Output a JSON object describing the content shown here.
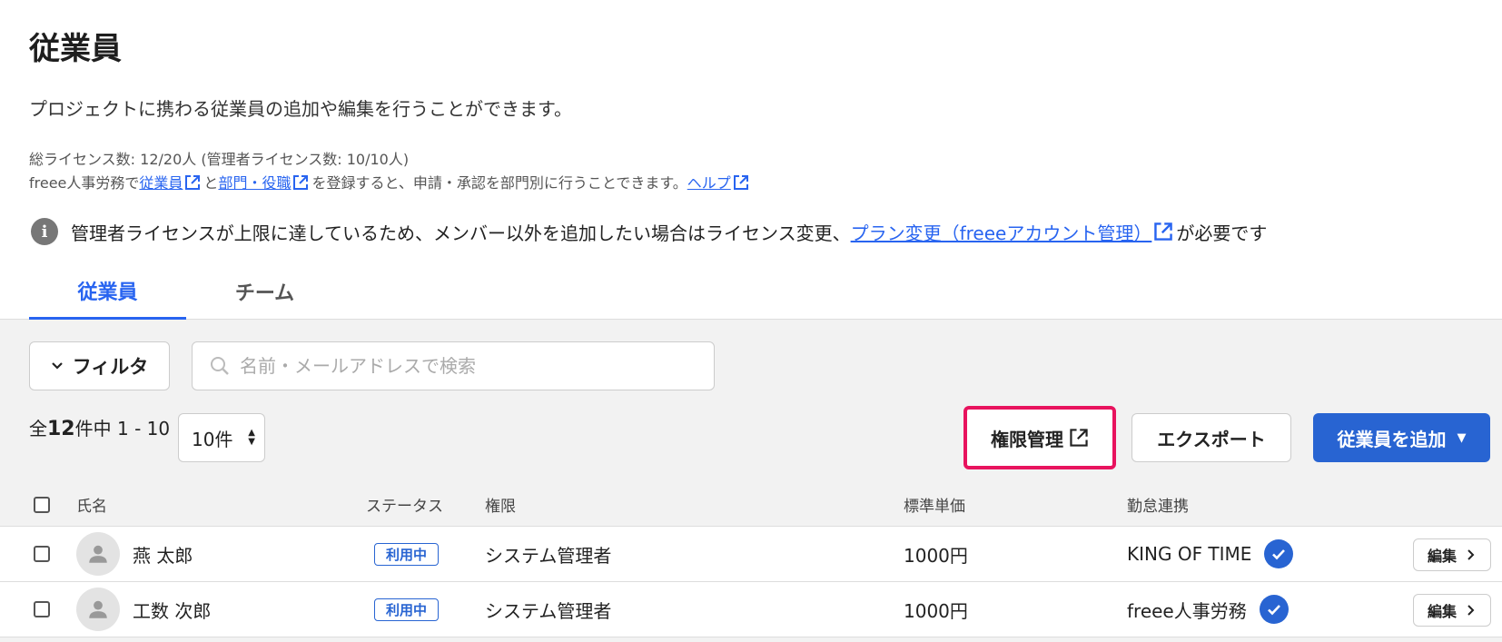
{
  "page": {
    "title": "従業員",
    "description": "プロジェクトに携わる従業員の追加や編集を行うことができます。",
    "license_text": "総ライセンス数: 12/20人 (管理者ライセンス数: 10/10人)",
    "freee_line": {
      "prefix": "freee人事労務で",
      "link_employees": "従業員",
      "mid": "と",
      "link_departments": "部門・役職",
      "suffix": "を登録すると、申請・承認を部門別に行うことできます。",
      "link_help": "ヘルプ"
    },
    "info": {
      "icon": "i",
      "text": "管理者ライセンスが上限に達しているため、メンバー以外を追加したい場合はライセンス変更、",
      "link": "プラン変更（freeeアカウント管理）",
      "suffix": "が必要です"
    }
  },
  "tabs": [
    {
      "label": "従業員",
      "active": true
    },
    {
      "label": "チーム",
      "active": false
    }
  ],
  "toolbar": {
    "filter_label": "フィルタ",
    "search_placeholder": "名前・メールアドレスで検索",
    "count_prefix": "全",
    "count_total": "12",
    "count_suffix": "件中 1 - 10",
    "per_page": "10件",
    "permission_button": "権限管理",
    "export_button": "エクスポート",
    "add_button": "従業員を追加"
  },
  "colors": {
    "accent": "#2864d2",
    "link": "#2864f0",
    "highlight": "#e8135e"
  },
  "table": {
    "headers": {
      "name": "氏名",
      "status": "ステータス",
      "role": "権限",
      "rate": "標準単価",
      "attendance": "勤怠連携"
    },
    "rows": [
      {
        "name": "燕 太郎",
        "status": "利用中",
        "role": "システム管理者",
        "rate": "1000円",
        "attendance": "KING OF TIME",
        "edit": "編集"
      },
      {
        "name": "工数 次郎",
        "status": "利用中",
        "role": "システム管理者",
        "rate": "1000円",
        "attendance": "freee人事労務",
        "edit": "編集"
      }
    ]
  }
}
